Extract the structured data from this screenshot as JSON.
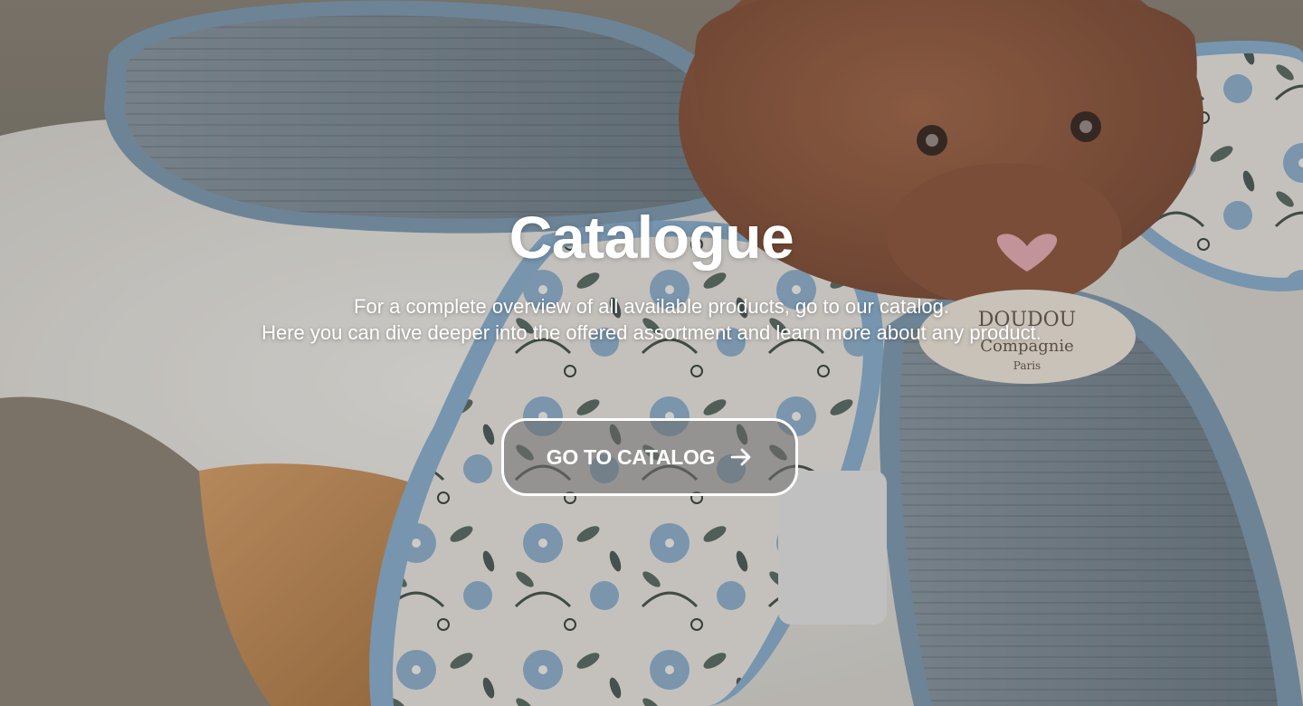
{
  "hero": {
    "title": "Catalogue",
    "description_line1": "For a complete overview of all available products, go to our catalog.",
    "description_line2": "Here you can dive deeper into the offered assortment and learn more about any product.",
    "cta_label": "GO TO CATALOG",
    "cta_icon": "arrow-right-icon",
    "background_image": "plush-bear-doudou-photo"
  },
  "colors": {
    "text": "#ffffff",
    "button_border": "#ffffff",
    "button_fill": "rgba(110,110,110,0.55)"
  }
}
